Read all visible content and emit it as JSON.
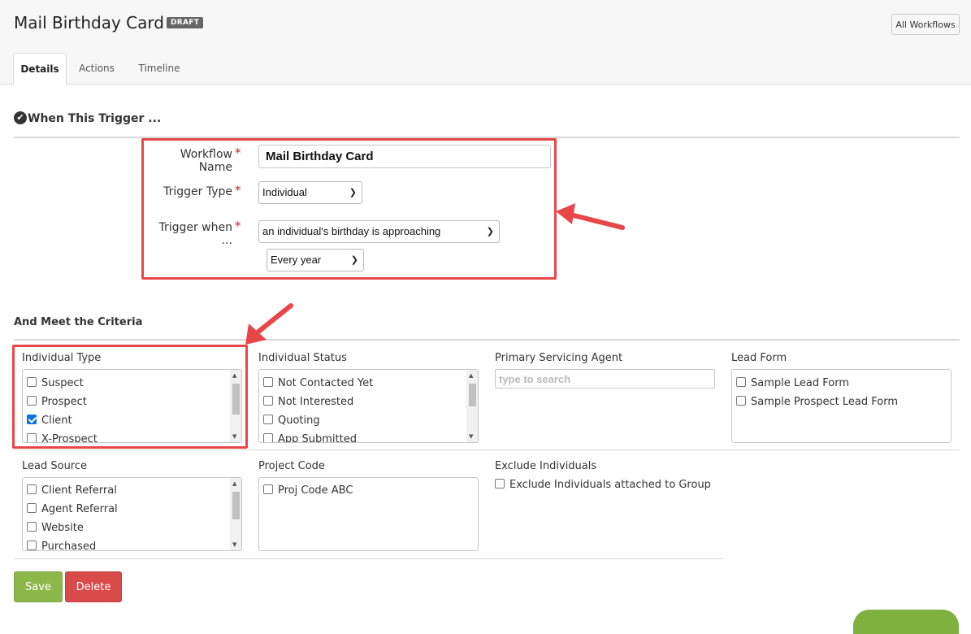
{
  "header": {
    "title": "Mail Birthday Card",
    "badge": "DRAFT",
    "all_workflows": "All Workflows",
    "tabs": [
      {
        "label": "Details"
      },
      {
        "label": "Actions"
      },
      {
        "label": "Timeline"
      }
    ]
  },
  "trigger_section": {
    "heading": "When This Trigger ...",
    "workflow_name_label": "Workflow Name",
    "workflow_name_value": "Mail Birthday Card",
    "trigger_type_label": "Trigger Type",
    "trigger_type_value": "Individual",
    "trigger_when_label": "Trigger when ...",
    "trigger_when_value": "an individual's birthday is approaching",
    "frequency_value": "Every year",
    "required_mark": "*"
  },
  "criteria": {
    "heading": "And Meet the Criteria",
    "individual_type": {
      "label": "Individual Type",
      "items": [
        {
          "label": "Suspect",
          "checked": false
        },
        {
          "label": "Prospect",
          "checked": false
        },
        {
          "label": "Client",
          "checked": true
        },
        {
          "label": "X-Prospect",
          "checked": false
        }
      ]
    },
    "individual_status": {
      "label": "Individual Status",
      "items": [
        {
          "label": "Not Contacted Yet",
          "checked": false
        },
        {
          "label": "Not Interested",
          "checked": false
        },
        {
          "label": "Quoting",
          "checked": false
        },
        {
          "label": "App Submitted",
          "checked": false
        }
      ]
    },
    "primary_agent": {
      "label": "Primary Servicing Agent",
      "placeholder": "type to search"
    },
    "lead_form": {
      "label": "Lead Form",
      "items": [
        {
          "label": "Sample Lead Form",
          "checked": false
        },
        {
          "label": "Sample Prospect Lead Form",
          "checked": false
        }
      ]
    },
    "lead_source": {
      "label": "Lead Source",
      "items": [
        {
          "label": "Client Referral",
          "checked": false
        },
        {
          "label": "Agent Referral",
          "checked": false
        },
        {
          "label": "Website",
          "checked": false
        },
        {
          "label": "Purchased",
          "checked": false
        }
      ]
    },
    "project_code": {
      "label": "Project Code",
      "items": [
        {
          "label": "Proj Code ABC",
          "checked": false
        }
      ]
    },
    "exclude": {
      "label": "Exclude Individuals",
      "option": "Exclude Individuals attached to Group",
      "checked": false
    }
  },
  "actions": {
    "save": "Save",
    "delete": "Delete"
  },
  "colors": {
    "highlight": "#e8474a",
    "save": "#8cb84a",
    "delete": "#d94a4a",
    "checkbox": "#0b74de"
  },
  "icons": {
    "section_check": "check-circle-icon",
    "annotation": "red-arrow-icon"
  }
}
